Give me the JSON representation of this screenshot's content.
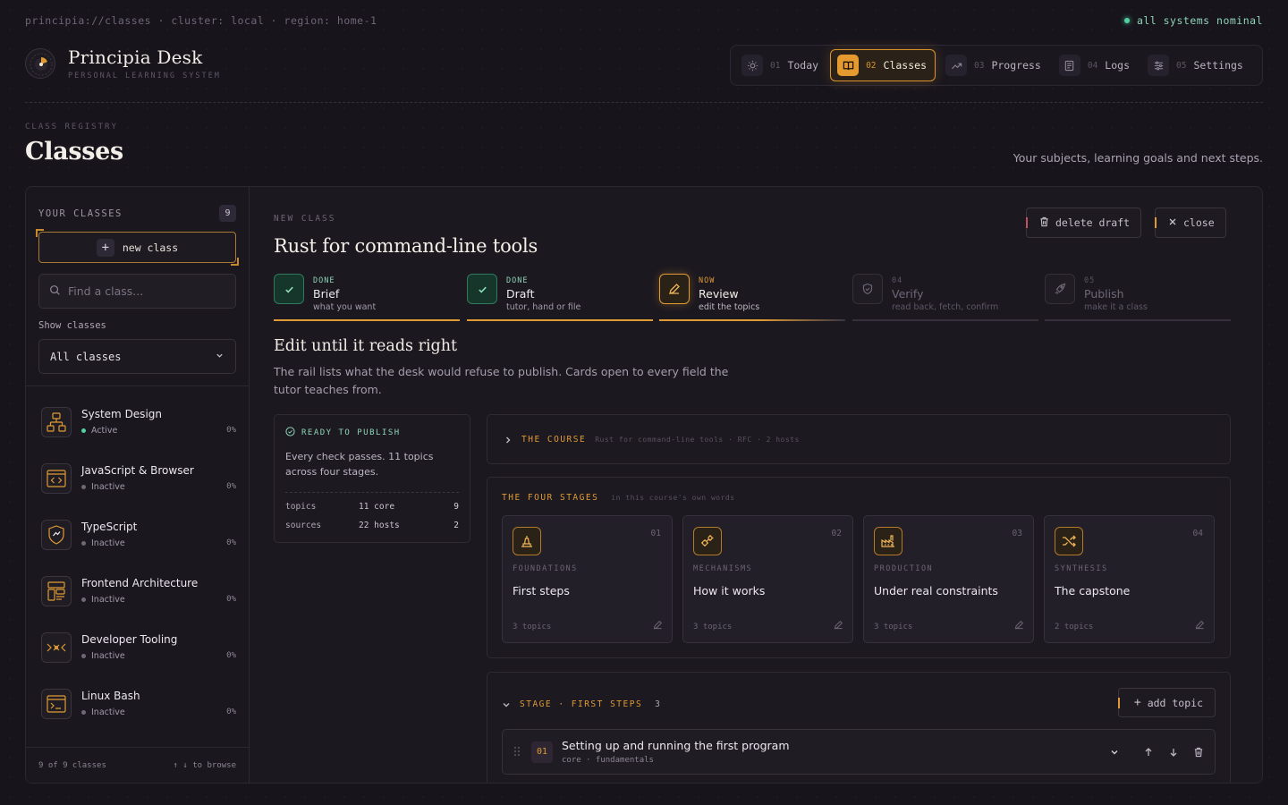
{
  "status": {
    "path": "principia://classes · cluster: local · region: home-1",
    "health": "all systems nominal"
  },
  "brand": {
    "title": "Principia Desk",
    "subtitle": "PERSONAL LEARNING SYSTEM"
  },
  "nav": [
    {
      "num": "01",
      "label": "Today",
      "icon": "sun-icon"
    },
    {
      "num": "02",
      "label": "Classes",
      "icon": "book-icon",
      "active": true
    },
    {
      "num": "03",
      "label": "Progress",
      "icon": "trend-icon"
    },
    {
      "num": "04",
      "label": "Logs",
      "icon": "log-icon"
    },
    {
      "num": "05",
      "label": "Settings",
      "icon": "sliders-icon"
    }
  ],
  "page": {
    "registry_label": "CLASS REGISTRY",
    "title": "Classes",
    "subtitle": "Your subjects, learning goals and next steps."
  },
  "sidebar": {
    "header": "YOUR CLASSES",
    "count": "9",
    "new_class": "new class",
    "search_placeholder": "Find a class...",
    "show_label": "Show classes",
    "filter_value": "All classes",
    "classes": [
      {
        "name": "System Design",
        "status": "Active",
        "pct": "0%",
        "icon": "diagram-icon"
      },
      {
        "name": "JavaScript & Browser",
        "status": "Inactive",
        "pct": "0%",
        "icon": "code-window-icon"
      },
      {
        "name": "TypeScript",
        "status": "Inactive",
        "pct": "0%",
        "icon": "shield-icon"
      },
      {
        "name": "Frontend Architecture",
        "status": "Inactive",
        "pct": "0%",
        "icon": "layout-icon"
      },
      {
        "name": "Developer Tooling",
        "status": "Inactive",
        "pct": "0%",
        "icon": "pipeline-icon"
      },
      {
        "name": "Linux Bash",
        "status": "Inactive",
        "pct": "0%",
        "icon": "terminal-icon"
      }
    ],
    "footer_count": "9 of 9 classes",
    "footer_hint": "↑ ↓ to browse"
  },
  "editor": {
    "label": "NEW CLASS",
    "title": "Rust for command-line tools",
    "delete_label": "delete draft",
    "close_label": "close",
    "steps": [
      {
        "tag": "DONE",
        "name": "Brief",
        "desc": "what you want",
        "state": "done"
      },
      {
        "tag": "DONE",
        "name": "Draft",
        "desc": "tutor, hand or file",
        "state": "done"
      },
      {
        "tag": "NOW",
        "name": "Review",
        "desc": "edit the topics",
        "state": "now"
      },
      {
        "tag": "04",
        "name": "Verify",
        "desc": "read back, fetch, confirm",
        "state": "todo"
      },
      {
        "tag": "05",
        "name": "Publish",
        "desc": "make it a class",
        "state": "todo"
      }
    ],
    "section_title": "Edit until it reads right",
    "section_desc": "The rail lists what the desk would refuse to publish. Cards open to every field the tutor teaches from.",
    "ready": {
      "label": "READY TO PUBLISH",
      "text": "Every check passes. 11 topics across four stages.",
      "rows": [
        {
          "k": "topics",
          "v": "11 core",
          "n": "9"
        },
        {
          "k": "sources",
          "v": "22 hosts",
          "n": "2"
        }
      ]
    },
    "course": {
      "label": "THE COURSE",
      "note": "Rust for command-line tools · RFC · 2 hosts"
    },
    "stages": {
      "label": "THE FOUR STAGES",
      "note": "in this course's own words",
      "cards": [
        {
          "num": "01",
          "kind": "FOUNDATIONS",
          "name": "First steps",
          "topics": "3 topics",
          "icon": "foundation-icon"
        },
        {
          "num": "02",
          "kind": "MECHANISMS",
          "name": "How it works",
          "topics": "3 topics",
          "icon": "gears-icon"
        },
        {
          "num": "03",
          "kind": "PRODUCTION",
          "name": "Under real constraints",
          "topics": "3 topics",
          "icon": "factory-icon"
        },
        {
          "num": "04",
          "kind": "SYNTHESIS",
          "name": "The capstone",
          "topics": "2 topics",
          "icon": "shuffle-icon"
        }
      ]
    },
    "stage_detail": {
      "label": "STAGE · FIRST STEPS",
      "count": "3",
      "add_topic": "add topic",
      "topic": {
        "num": "01",
        "title": "Setting up and running the first program",
        "meta": "core · fundamentals"
      }
    }
  },
  "colors": {
    "accent": "#e09a34",
    "success": "#4fd1a1",
    "background": "#17141c"
  }
}
